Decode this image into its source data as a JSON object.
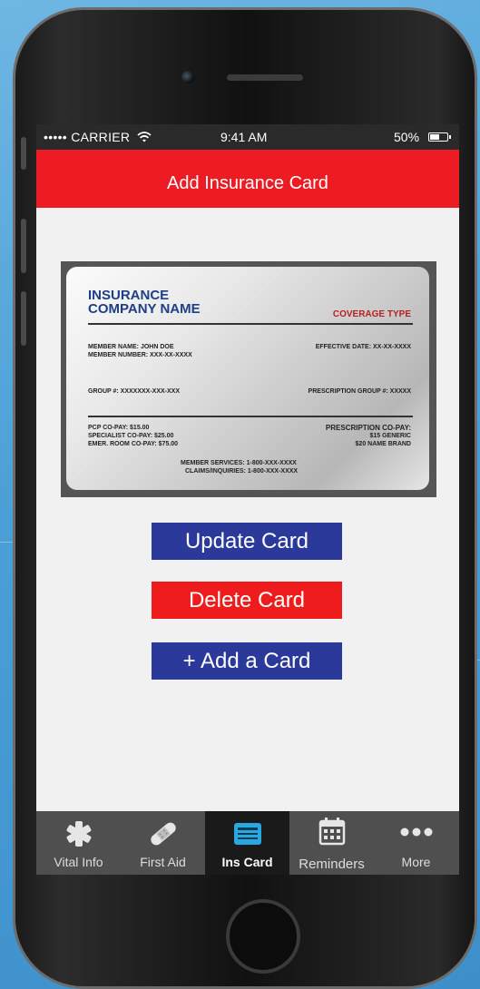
{
  "status_bar": {
    "carrier": "••••• CARRIER",
    "time": "9:41 AM",
    "battery": "50%"
  },
  "nav": {
    "title": "Add Insurance Card"
  },
  "insurance_card": {
    "company_line1": "INSURANCE",
    "company_line2": "COMPANY NAME",
    "coverage_type": "COVERAGE TYPE",
    "member_name": "MEMBER NAME:  JOHN DOE",
    "member_number": "MEMBER NUMBER: XXX-XX-XXXX",
    "effective_date": "EFFECTIVE DATE: XX-XX-XXXX",
    "group": "GROUP #:  XXXXXXX-XXX-XXX",
    "prescription_group": "PRESCRIPTION GROUP #:  XXXXX",
    "pcp_copay": "PCP CO-PAY: $15.00",
    "specialist_copay": "SPECIALIST CO-PAY: $25.00",
    "emer_copay": "EMER. ROOM CO-PAY: $75.00",
    "rx_copay_label": "PRESCRIPTION CO-PAY:",
    "rx_generic": "$15 GENERIC",
    "rx_name_brand": "$20 NAME BRAND",
    "member_services": "MEMBER SERVICES: 1-800-XXX-XXXX",
    "claims": "CLAIMS/INQUIRIES: 1-800-XXX-XXXX"
  },
  "buttons": {
    "update": "Update Card",
    "delete": "Delete Card",
    "add": "+ Add a Card"
  },
  "tabs": [
    {
      "label": "Vital Info",
      "icon": "medical-star-icon"
    },
    {
      "label": "First Aid",
      "icon": "bandage-icon"
    },
    {
      "label": "Ins Card",
      "icon": "id-card-icon",
      "active": true
    },
    {
      "label": "Reminders",
      "icon": "calendar-icon"
    },
    {
      "label": "More",
      "icon": "more-dots-icon"
    }
  ],
  "colors": {
    "accent_red": "#ed1c24",
    "button_blue": "#2b3a9a",
    "tab_bar": "#4f4f4f",
    "active_icon": "#29a8e0"
  }
}
